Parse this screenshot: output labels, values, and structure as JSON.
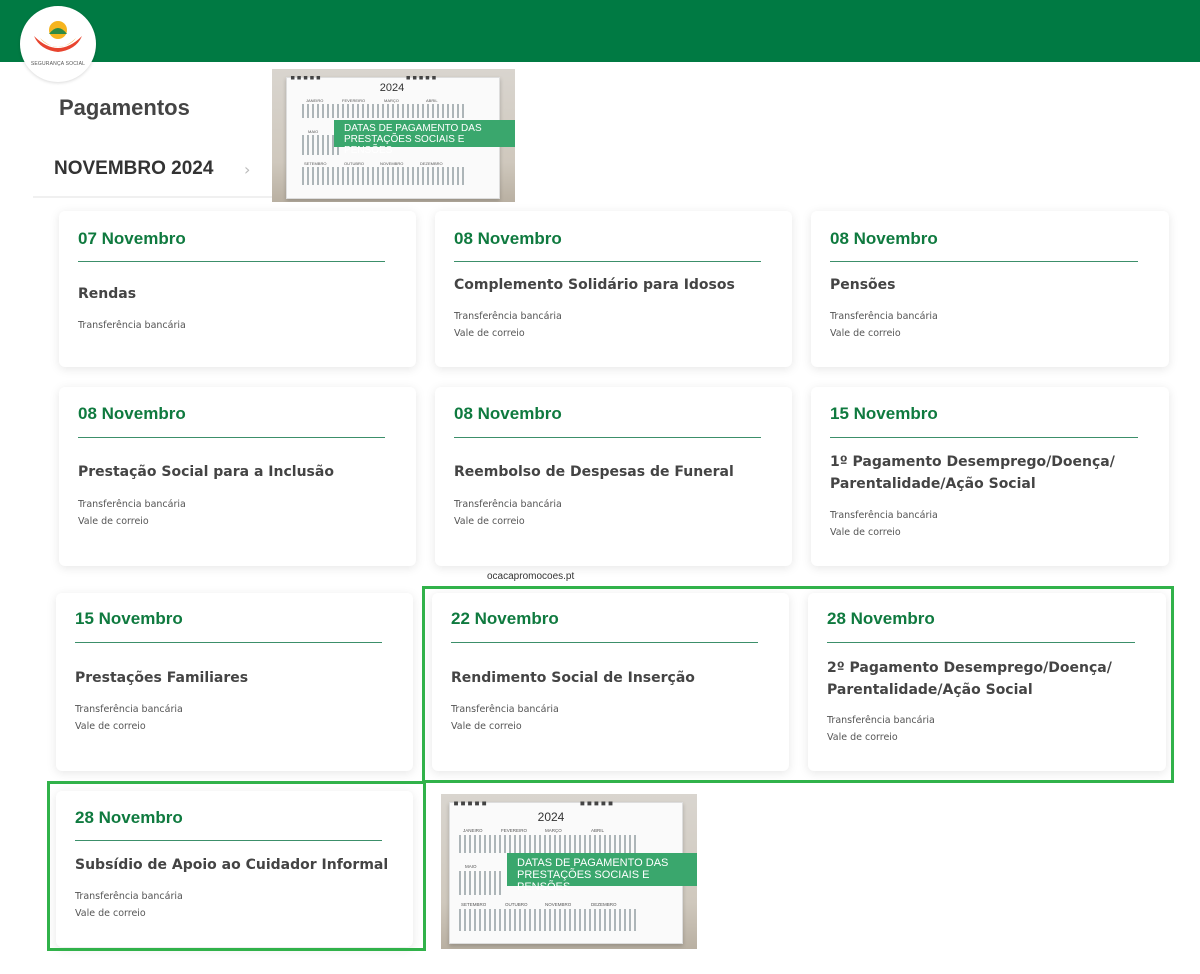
{
  "brand": {
    "logo_text": "SEGURANÇA SOCIAL",
    "color_header": "#007a43",
    "color_accent": "#0f7a3f",
    "color_highlight": "#31b24a"
  },
  "page": {
    "title": "Pagamentos",
    "month": "NOVEMBRO 2024",
    "next_icon": "chevron-right-icon"
  },
  "promo": {
    "year": "2024",
    "months": [
      "JANEIRO",
      "FEVEREIRO",
      "MARÇO",
      "ABRIL",
      "MAIO",
      "SETEMBRO",
      "OUTUBRO",
      "NOVEMBRO",
      "DEZEMBRO"
    ],
    "banner_line1": "DATAS DE PAGAMENTO DAS",
    "banner_line2": "PRESTAÇÕES SOCIAIS E PENSÕES"
  },
  "watermark": "ocacapromocoes.pt",
  "cards": [
    {
      "date": "07 Novembro",
      "name": "Rendas",
      "methods": [
        "Transferência bancária"
      ]
    },
    {
      "date": "08 Novembro",
      "name": "Complemento Solidário para Idosos",
      "methods": [
        "Transferência bancária",
        "Vale de correio"
      ]
    },
    {
      "date": "08 Novembro",
      "name": "Pensões",
      "methods": [
        "Transferência bancária",
        "Vale de correio"
      ]
    },
    {
      "date": "08 Novembro",
      "name": "Prestação Social para a Inclusão",
      "methods": [
        "Transferência bancária",
        "Vale de correio"
      ]
    },
    {
      "date": "08 Novembro",
      "name": "Reembolso de Despesas de Funeral",
      "methods": [
        "Transferência bancária",
        "Vale de correio"
      ]
    },
    {
      "date": "15 Novembro",
      "name_lines": [
        "1º Pagamento Desemprego/Doença/",
        "Parentalidade/Ação Social"
      ],
      "methods": [
        "Transferência bancária",
        "Vale de correio"
      ]
    },
    {
      "date": "15 Novembro",
      "name": "Prestações Familiares",
      "methods": [
        "Transferência bancária",
        "Vale de correio"
      ]
    },
    {
      "date": "22 Novembro",
      "name": "Rendimento Social de Inserção",
      "methods": [
        "Transferência bancária",
        "Vale de correio"
      ]
    },
    {
      "date": "28 Novembro",
      "name_lines": [
        "2º Pagamento Desemprego/Doença/",
        "Parentalidade/Ação Social"
      ],
      "methods": [
        "Transferência bancária",
        "Vale de correio"
      ]
    },
    {
      "date": "28 Novembro",
      "name": "Subsídio de Apoio ao Cuidador Informal",
      "methods": [
        "Transferência bancária",
        "Vale de correio"
      ]
    }
  ]
}
